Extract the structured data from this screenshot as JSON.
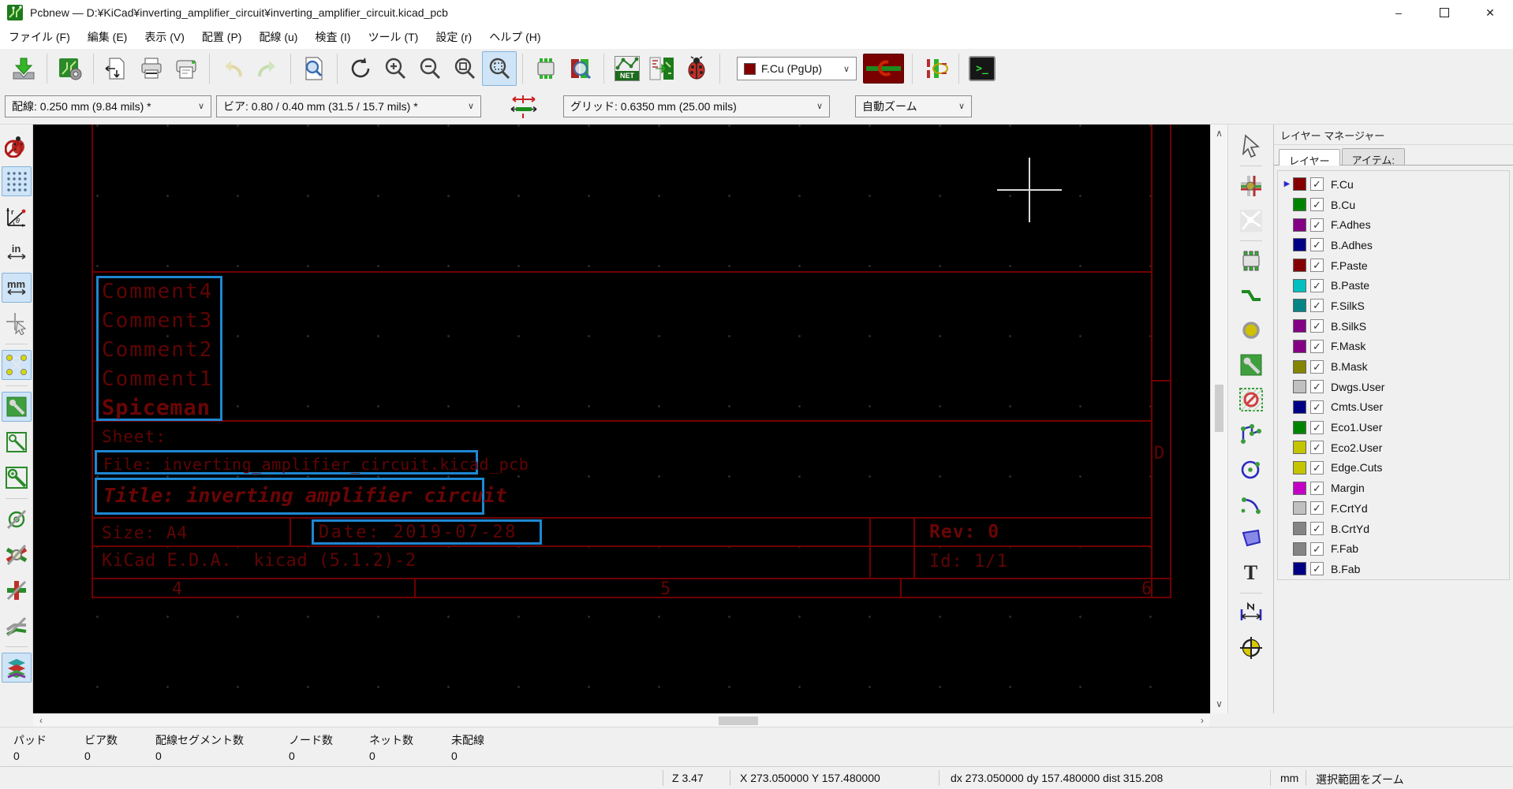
{
  "window": {
    "title": "Pcbnew — D:¥KiCad¥inverting_amplifier_circuit¥inverting_amplifier_circuit.kicad_pcb"
  },
  "menu": {
    "items": [
      "ファイル (F)",
      "編集 (E)",
      "表示 (V)",
      "配置 (P)",
      "配線 (u)",
      "検査 (I)",
      "ツール (T)",
      "設定 (r)",
      "ヘルプ (H)"
    ]
  },
  "toolbar": {
    "layer_select": "F.Cu (PgUp)",
    "layer_select_color": "#840000",
    "track_width": "配線: 0.250 mm (9.84 mils) *",
    "via_size": "ビア: 0.80 / 0.40 mm (31.5 / 15.7 mils) *",
    "grid": "グリッド: 0.6350 mm (25.00 mils)",
    "zoom": "自動ズーム"
  },
  "canvas": {
    "comments": [
      "Comment4",
      "Comment3",
      "Comment2",
      "Comment1"
    ],
    "author": "Spiceman",
    "sheet_label": "Sheet:",
    "file_label": "File: inverting_amplifier_circuit.kicad_pcb",
    "title_label": "Title: inverting amplifier circuit",
    "size_label": "Size: A4",
    "date_label": "Date: 2019-07-28",
    "rev_label": "Rev: 0",
    "kicad_label": "KiCad E.D.A.  kicad (5.1.2)-2",
    "id_label": "Id: 1/1",
    "grid_col_4": "4",
    "grid_col_5": "5",
    "grid_col_6": "6",
    "grid_row_d": "D",
    "selection_blue": "#1e87d2",
    "draw_color": "#700000"
  },
  "layer_manager": {
    "title": "レイヤー マネージャー",
    "tab_layers": "レイヤー",
    "tab_items": "アイテム:",
    "items": [
      {
        "name": "F.Cu",
        "color": "#840000",
        "checked": true,
        "active": true
      },
      {
        "name": "B.Cu",
        "color": "#008400",
        "checked": true
      },
      {
        "name": "F.Adhes",
        "color": "#840084",
        "checked": true
      },
      {
        "name": "B.Adhes",
        "color": "#000084",
        "checked": true
      },
      {
        "name": "F.Paste",
        "color": "#840000",
        "checked": true
      },
      {
        "name": "B.Paste",
        "color": "#00c0c0",
        "checked": true
      },
      {
        "name": "F.SilkS",
        "color": "#008484",
        "checked": true
      },
      {
        "name": "B.SilkS",
        "color": "#840084",
        "checked": true
      },
      {
        "name": "F.Mask",
        "color": "#840084",
        "checked": true
      },
      {
        "name": "B.Mask",
        "color": "#848400",
        "checked": true
      },
      {
        "name": "Dwgs.User",
        "color": "#c0c0c0",
        "checked": true
      },
      {
        "name": "Cmts.User",
        "color": "#000084",
        "checked": true
      },
      {
        "name": "Eco1.User",
        "color": "#008400",
        "checked": true
      },
      {
        "name": "Eco2.User",
        "color": "#c4c400",
        "checked": true
      },
      {
        "name": "Edge.Cuts",
        "color": "#c4c400",
        "checked": true
      },
      {
        "name": "Margin",
        "color": "#c400c4",
        "checked": true
      },
      {
        "name": "F.CrtYd",
        "color": "#c0c0c0",
        "checked": true
      },
      {
        "name": "B.CrtYd",
        "color": "#848484",
        "checked": true
      },
      {
        "name": "F.Fab",
        "color": "#848484",
        "checked": true
      },
      {
        "name": "B.Fab",
        "color": "#000084",
        "checked": true
      }
    ]
  },
  "status": {
    "pads_label": "パッド",
    "pads_value": "0",
    "vias_label": "ビア数",
    "vias_value": "0",
    "segments_label": "配線セグメント数",
    "segments_value": "0",
    "nodes_label": "ノード数",
    "nodes_value": "0",
    "nets_label": "ネット数",
    "nets_value": "0",
    "unrouted_label": "未配線",
    "unrouted_value": "0",
    "zoom_level": "Z 3.47",
    "cursor_pos": "X 273.050000  Y 157.480000",
    "delta": "dx 273.050000  dy 157.480000  dist 315.208",
    "units": "mm",
    "action_hint": "選択範囲をズーム"
  },
  "icons": {
    "check": "✓",
    "active_arrow": "▶",
    "combo_chevron": "∨",
    "scroll_up": "∧",
    "scroll_down": "∨",
    "scroll_left": "‹",
    "scroll_right": "›",
    "netlist": "NET",
    "units_in": "in",
    "units_mm": "mm",
    "text_tool": "T",
    "console_prompt": "&gt;_",
    "minimize": "–",
    "close": "✕"
  }
}
